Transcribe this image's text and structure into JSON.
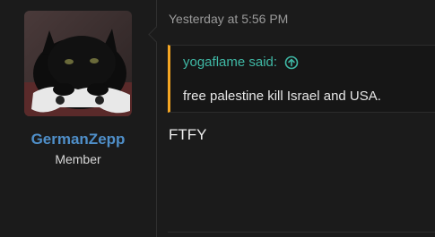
{
  "post": {
    "timestamp": "Yesterday at 5:56 PM",
    "message": "FTFY"
  },
  "author": {
    "username": "GermanZepp",
    "title": "Member",
    "avatar_icon": "black-cat-avatar"
  },
  "quote": {
    "header": "yogaflame said:",
    "icon": "arrow-up-circle-icon",
    "body": "free palestine kill Israel and USA."
  },
  "colors": {
    "background": "#1b1b1b",
    "username": "#4f8fc9",
    "quote_accent": "#f5a623",
    "quote_author": "#3fb8a5"
  }
}
